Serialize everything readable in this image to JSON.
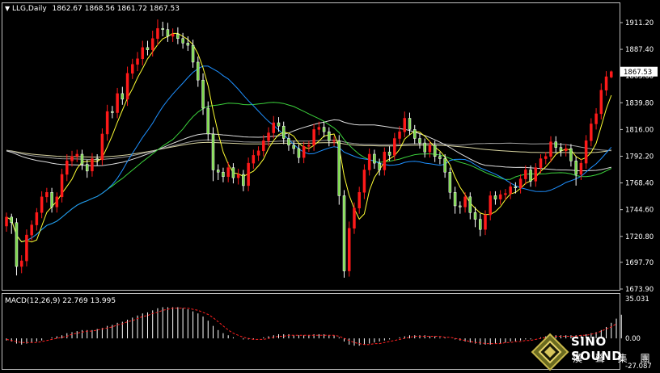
{
  "header": {
    "symbol": "LLG,Daily",
    "ohlc": "1862.67 1868.56 1861.72 1867.53",
    "arrow": "▼"
  },
  "macd": {
    "title": "MACD(12,26,9) 22.769 13.995",
    "scale_top": "35.031",
    "scale_zero": "0.00",
    "scale_bottom": "-27.087"
  },
  "brand": {
    "name": "SINO SOUND",
    "chinese": "漢 聲 集 團",
    "logo_icon": "diamond-logo-icon"
  },
  "colors": {
    "bull": "#ff1a1a",
    "bear": "#ffffff",
    "bear_body": "#7bd84a",
    "ma_yellow": "#ffff33",
    "ma_blue": "#1e90ff",
    "ma_green": "#3cd23c",
    "ma_white": "#dddddd",
    "ma_khaki": "#d8d4a0",
    "ma_gray": "#a0a0a0",
    "macd_signal": "#ff2020",
    "price_tag_bg": "#ffffff"
  },
  "chart_data": {
    "type": "candlestick",
    "price_axis": {
      "ticks": [
        1911.2,
        1887.4,
        1863.6,
        1839.8,
        1816.0,
        1792.2,
        1768.4,
        1744.6,
        1720.8,
        1697.7,
        1673.9
      ],
      "ylim": [
        1673.9,
        1911.2
      ],
      "current_price": "1867.53"
    },
    "macd_axis": {
      "ylim": [
        -27.087,
        35.031
      ]
    },
    "close": [
      1738,
      1733,
      1694,
      1699,
      1722,
      1731,
      1742,
      1756,
      1760,
      1747,
      1756,
      1776,
      1788,
      1792,
      1794,
      1785,
      1779,
      1790,
      1789,
      1812,
      1832,
      1831,
      1848,
      1843,
      1866,
      1874,
      1879,
      1889,
      1887,
      1897,
      1906,
      1905,
      1899,
      1901,
      1897,
      1893,
      1891,
      1876,
      1860,
      1835,
      1812,
      1780,
      1778,
      1774,
      1782,
      1773,
      1776,
      1766,
      1786,
      1793,
      1797,
      1806,
      1813,
      1822,
      1819,
      1808,
      1802,
      1799,
      1791,
      1801,
      1802,
      1816,
      1818,
      1814,
      1806,
      1806,
      1757,
      1690,
      1728,
      1746,
      1760,
      1780,
      1794,
      1786,
      1780,
      1796,
      1793,
      1808,
      1814,
      1826,
      1816,
      1808,
      1804,
      1796,
      1802,
      1792,
      1790,
      1778,
      1760,
      1748,
      1747,
      1756,
      1742,
      1736,
      1727,
      1740,
      1757,
      1754,
      1758,
      1759,
      1765,
      1764,
      1772,
      1780,
      1770,
      1782,
      1790,
      1792,
      1805,
      1800,
      1797,
      1799,
      1788,
      1776,
      1786,
      1806,
      1821,
      1830,
      1851,
      1863,
      1867.53
    ],
    "open": [
      1730,
      1738,
      1733,
      1694,
      1699,
      1722,
      1731,
      1742,
      1756,
      1760,
      1747,
      1756,
      1776,
      1788,
      1792,
      1794,
      1785,
      1779,
      1790,
      1789,
      1812,
      1832,
      1831,
      1848,
      1843,
      1866,
      1874,
      1879,
      1889,
      1887,
      1897,
      1906,
      1905,
      1899,
      1901,
      1897,
      1893,
      1891,
      1876,
      1860,
      1835,
      1812,
      1780,
      1778,
      1774,
      1782,
      1773,
      1776,
      1766,
      1786,
      1793,
      1797,
      1806,
      1813,
      1822,
      1819,
      1808,
      1802,
      1799,
      1791,
      1801,
      1802,
      1816,
      1818,
      1814,
      1806,
      1806,
      1757,
      1690,
      1728,
      1746,
      1760,
      1780,
      1794,
      1786,
      1780,
      1796,
      1793,
      1808,
      1814,
      1826,
      1816,
      1808,
      1804,
      1796,
      1802,
      1792,
      1790,
      1778,
      1760,
      1748,
      1747,
      1756,
      1742,
      1736,
      1727,
      1740,
      1757,
      1754,
      1758,
      1759,
      1765,
      1764,
      1772,
      1780,
      1770,
      1782,
      1790,
      1792,
      1805,
      1800,
      1797,
      1799,
      1788,
      1776,
      1786,
      1806,
      1821,
      1830,
      1851,
      1862.67
    ],
    "high_offset": [
      4,
      3,
      4,
      5,
      5,
      4,
      4,
      5,
      4,
      4,
      4,
      5,
      6,
      5,
      4,
      4,
      4,
      5,
      4,
      5,
      6,
      5,
      5,
      6,
      6,
      5,
      6,
      6,
      6,
      7,
      8,
      6,
      6,
      5,
      6,
      5,
      6,
      5,
      5,
      6,
      6,
      6,
      5,
      4,
      5,
      4,
      5,
      4,
      5,
      5,
      4,
      5,
      5,
      6,
      5,
      4,
      4,
      4,
      4,
      4,
      4,
      5,
      5,
      5,
      4,
      4,
      5,
      5,
      6,
      5,
      5,
      5,
      5,
      4,
      4,
      4,
      5,
      5,
      5,
      6,
      5,
      4,
      4,
      4,
      4,
      4,
      4,
      4,
      4,
      5,
      4,
      4,
      4,
      5,
      5,
      4,
      4,
      4,
      4,
      4,
      4,
      4,
      4,
      4,
      4,
      4,
      4,
      4,
      5,
      5,
      4,
      4,
      4,
      4,
      4,
      5,
      5,
      5,
      6,
      5,
      1
    ],
    "low_offset": [
      5,
      10,
      8,
      6,
      5,
      5,
      5,
      5,
      5,
      5,
      5,
      5,
      6,
      5,
      5,
      5,
      6,
      5,
      5,
      5,
      6,
      5,
      5,
      5,
      6,
      5,
      6,
      6,
      5,
      6,
      6,
      6,
      5,
      5,
      5,
      5,
      5,
      5,
      6,
      6,
      6,
      10,
      7,
      5,
      5,
      5,
      6,
      5,
      5,
      5,
      5,
      5,
      5,
      5,
      5,
      5,
      5,
      5,
      5,
      5,
      5,
      5,
      5,
      5,
      5,
      5,
      8,
      6,
      5,
      5,
      5,
      6,
      5,
      5,
      5,
      5,
      5,
      5,
      5,
      5,
      5,
      5,
      5,
      5,
      5,
      5,
      5,
      5,
      6,
      7,
      6,
      5,
      6,
      7,
      6,
      5,
      5,
      5,
      5,
      5,
      5,
      5,
      5,
      5,
      5,
      5,
      5,
      5,
      5,
      5,
      5,
      5,
      5,
      10,
      5,
      5,
      5,
      5,
      5,
      5,
      1
    ],
    "macd_hist": [
      -2,
      -3,
      -5,
      -6,
      -5,
      -4,
      -3,
      -2,
      0,
      1,
      2,
      3,
      5,
      6,
      7,
      8,
      8,
      8,
      9,
      10,
      12,
      13,
      15,
      16,
      18,
      20,
      22,
      24,
      25,
      27,
      29,
      30,
      30,
      30,
      30,
      29,
      28,
      26,
      24,
      21,
      17,
      12,
      8,
      5,
      3,
      1,
      0,
      -1,
      -1,
      -1,
      0,
      1,
      2,
      3,
      4,
      4,
      4,
      3,
      3,
      3,
      3,
      4,
      4,
      4,
      3,
      3,
      1,
      -3,
      -6,
      -7,
      -7,
      -6,
      -5,
      -4,
      -3,
      -2,
      -1,
      0,
      1,
      2,
      3,
      3,
      3,
      3,
      2,
      2,
      1,
      1,
      0,
      -1,
      -2,
      -3,
      -4,
      -5,
      -6,
      -6,
      -6,
      -5,
      -5,
      -4,
      -3,
      -3,
      -2,
      -1,
      -1,
      0,
      1,
      2,
      3,
      3,
      3,
      3,
      3,
      3,
      3,
      4,
      5,
      6,
      8,
      11,
      15,
      19,
      22.769
    ],
    "macd_signal": [
      -1,
      -2,
      -3,
      -4,
      -4,
      -4,
      -4,
      -3,
      -2,
      -1,
      0,
      1,
      2,
      4,
      5,
      6,
      7,
      7,
      8,
      9,
      10,
      11,
      13,
      14,
      16,
      17,
      19,
      21,
      22,
      24,
      25,
      27,
      28,
      29,
      29,
      29,
      29,
      28,
      27,
      25,
      23,
      20,
      16,
      12,
      8,
      5,
      3,
      1,
      0,
      -1,
      -1,
      -1,
      0,
      1,
      2,
      2,
      3,
      3,
      3,
      3,
      3,
      3,
      3,
      3,
      3,
      3,
      2,
      0,
      -2,
      -4,
      -5,
      -6,
      -6,
      -5,
      -5,
      -4,
      -3,
      -2,
      -1,
      0,
      1,
      2,
      2,
      2,
      2,
      2,
      2,
      1,
      1,
      0,
      -1,
      -2,
      -3,
      -4,
      -4,
      -5,
      -5,
      -5,
      -5,
      -4,
      -4,
      -3,
      -3,
      -2,
      -2,
      -1,
      0,
      1,
      1,
      2,
      2,
      2,
      2,
      2,
      3,
      3,
      4,
      5,
      7,
      9,
      11,
      13.995
    ]
  }
}
